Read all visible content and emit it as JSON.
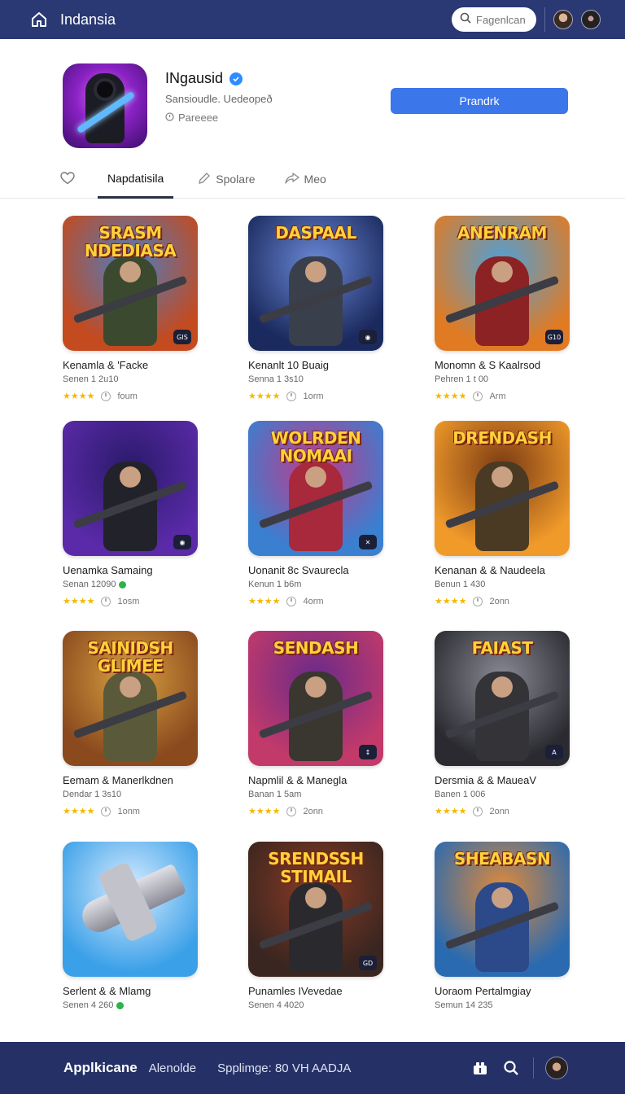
{
  "topbar": {
    "brand": "Indansia",
    "search_placeholder": "Fagenlcan"
  },
  "app": {
    "title": "INgausid",
    "subtitle": "Sansioudle. Uedeopeð",
    "meta": "Pareeee",
    "primary_button": "Prandrk"
  },
  "tabs": {
    "active": "Napdatisila",
    "explore": "Spolare",
    "share": "Meo"
  },
  "games": [
    {
      "banner": "SRASM NDEDIASA",
      "title": "Kenamla & 'Facke",
      "sub": "Senen 1 2u10",
      "time": "foum",
      "badge": "GIS",
      "verified": false,
      "thumb_bg": "#c44a1f",
      "thumb_bg2": "#4c7dc0",
      "hero": "#3b4a2e"
    },
    {
      "banner": "DASPAAL",
      "title": "Kenanlt 10 Buaig",
      "sub": "Senna 1 3s10",
      "time": "1orm",
      "badge": "◉",
      "verified": false,
      "thumb_bg": "#1b2a5e",
      "thumb_bg2": "#6a88d6",
      "hero": "#3a3f4c"
    },
    {
      "banner": "ANENRAM",
      "title": "Monomn & S Kaalrsod",
      "sub": "Pehren 1 t 00",
      "time": "Arm",
      "badge": "G10",
      "verified": false,
      "thumb_bg": "#e07b24",
      "thumb_bg2": "#4fa0d8",
      "hero": "#8c2224"
    },
    {
      "banner": "",
      "title": "Uenamka Samaing",
      "sub": "Senan 12090",
      "time": "1osm",
      "badge": "◉",
      "verified": true,
      "thumb_bg": "#5a2aa8",
      "thumb_bg2": "#2a1a6a",
      "hero": "#22222a"
    },
    {
      "banner": "WOLRDEN NOMAAI",
      "title": "Uonanit 8c Svaurecla",
      "sub": "Kenun 1 b6m",
      "time": "4orm",
      "badge": "✕",
      "verified": false,
      "thumb_bg": "#3a7fd0",
      "thumb_bg2": "#c23a8a",
      "hero": "#a8283c"
    },
    {
      "banner": "DRENDASH",
      "title": "Kenanan & & Naudeela",
      "sub": "Benun 1 430",
      "time": "2onn",
      "badge": "",
      "verified": false,
      "thumb_bg": "#f09a2a",
      "thumb_bg2": "#7a3a14",
      "hero": "#4a3a24"
    },
    {
      "banner": "SAINIDSH GLIMEE",
      "title": "Eemam & Manerlkdnen",
      "sub": "Dendar 1 3s10",
      "time": "1onm",
      "badge": "",
      "verified": false,
      "thumb_bg": "#8a4a1e",
      "thumb_bg2": "#d8a040",
      "hero": "#5a5a3a"
    },
    {
      "banner": "SENDASH",
      "title": "Napmlil & & Manegla",
      "sub": "Banan 1 5am",
      "time": "2onn",
      "badge": "↕",
      "verified": false,
      "thumb_bg": "#c23a6a",
      "thumb_bg2": "#6a2a8a",
      "hero": "#3a3630"
    },
    {
      "banner": "FAIAST",
      "title": "Dersmia & & MaueaV",
      "sub": "Banen 1 006",
      "time": "2onn",
      "badge": "A",
      "verified": false,
      "thumb_bg": "#2a2a30",
      "thumb_bg2": "#8a8a96",
      "hero": "#333338"
    },
    {
      "banner": "",
      "title": "Serlent & & Mlamg",
      "sub": "Senen 4 260",
      "time": "",
      "badge": "",
      "verified": true,
      "thumb_bg": "#3aa0e8",
      "thumb_bg2": "#d8ecff",
      "hero": "",
      "plane": true
    },
    {
      "banner": "SRENDSSH STIMAIL",
      "title": "Punamles IVevedae",
      "sub": "Senen 4 4020",
      "time": "",
      "badge": "GD",
      "verified": false,
      "thumb_bg": "#3a2620",
      "thumb_bg2": "#8a3a24",
      "hero": "#2a2a2e"
    },
    {
      "banner": "SHEABASN",
      "title": "Uoraom Pertalmgiay",
      "sub": "Semun 14 235",
      "time": "",
      "badge": "",
      "verified": false,
      "thumb_bg": "#2a6ab0",
      "thumb_bg2": "#e08a3a",
      "hero": "#2c4a8a"
    }
  ],
  "bottombar": {
    "brand": "Applkicane",
    "link": "Alenolde",
    "status": "Spplimge: 80  VH AADJA"
  }
}
